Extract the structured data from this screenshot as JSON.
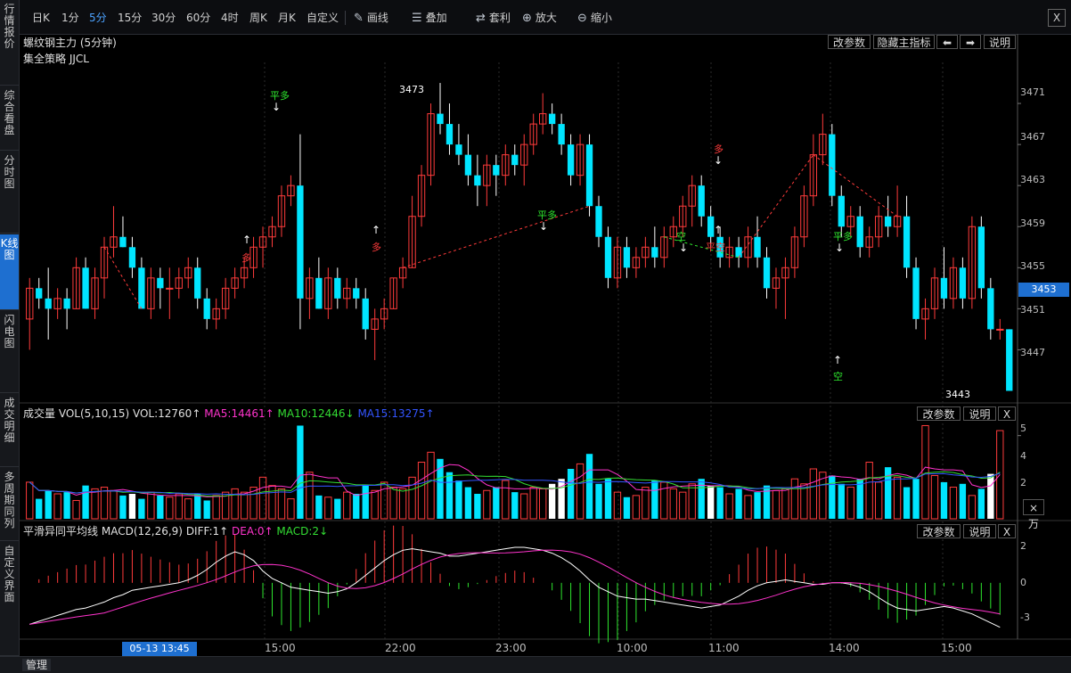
{
  "sidebar": {
    "tabs": [
      {
        "label": "行情报价"
      },
      {
        "label": "综合看盘"
      },
      {
        "label": "分时图"
      },
      {
        "label": "K线图"
      },
      {
        "label": "闪电图"
      },
      {
        "label": "成交明细"
      },
      {
        "label": "多周期同列"
      },
      {
        "label": "自定义界面"
      }
    ]
  },
  "toolbar": {
    "periods": [
      "日K",
      "1分",
      "5分",
      "15分",
      "30分",
      "60分",
      "4时",
      "周K",
      "月K",
      "自定义"
    ],
    "active_period": "5分",
    "tools": [
      "画线",
      "叠加",
      "套利",
      "放大",
      "缩小"
    ],
    "close": "X"
  },
  "main_panel": {
    "title": "螺纹钢主力 (5分钟)",
    "strategy": "集全策略 JJCL",
    "buttons": {
      "params": "改参数",
      "hide_main": "隐藏主指标",
      "left": "⬅",
      "right": "➡",
      "help": "说明"
    },
    "price_axis": [
      "3471",
      "3467",
      "3463",
      "3459",
      "3455",
      "3451",
      "3447"
    ],
    "current_price": "3453",
    "high_label": "3473",
    "low_label": "3443",
    "signals": [
      {
        "text": "平多",
        "color": "green"
      },
      {
        "text": "多",
        "color": "red"
      },
      {
        "text": "多",
        "color": "red"
      },
      {
        "text": "平多",
        "color": "green"
      },
      {
        "text": "空",
        "color": "green"
      },
      {
        "text": "平空",
        "color": "red"
      },
      {
        "text": "多",
        "color": "red"
      },
      {
        "text": "平多",
        "color": "green"
      },
      {
        "text": "空",
        "color": "green"
      }
    ]
  },
  "volume_panel": {
    "label": "成交量",
    "indicator": "VOL(5,10,15)",
    "vol": "VOL:12760↑",
    "ma5": "MA5:14461↑",
    "ma10": "MA10:12446↓",
    "ma15": "MA15:13275↑",
    "buttons": {
      "params": "改参数",
      "help": "说明",
      "close": "X"
    },
    "axis": [
      "5",
      "4",
      "2"
    ],
    "unit": "×万",
    "colors": {
      "ma5": "#ff33cc",
      "ma10": "#33dd33",
      "ma15": "#3355ff"
    }
  },
  "macd_panel": {
    "label": "平滑异同平均线",
    "indicator": "MACD(12,26,9)",
    "diff": "DIFF:1↑",
    "dea": "DEA:0↑",
    "macd": "MACD:2↓",
    "buttons": {
      "params": "改参数",
      "help": "说明",
      "close": "X"
    },
    "axis": [
      "2",
      "0",
      "-3"
    ]
  },
  "time_axis": {
    "cursor": "05-13 13:45",
    "labels": [
      "15:00",
      "22:00",
      "23:00",
      "10:00",
      "11:00",
      "14:00",
      "15:00"
    ]
  },
  "bottom": {
    "manage": "管理"
  },
  "colors": {
    "up": "#ff3b3b",
    "down": "#00e5ff",
    "accent": "#1e6fd0"
  },
  "chart_data": {
    "type": "candlestick",
    "title": "螺纹钢主力 (5分钟)",
    "ylim": [
      3443,
      3473
    ],
    "candles": [
      [
        3450,
        3454,
        3447,
        3453
      ],
      [
        3453,
        3454,
        3451,
        3452
      ],
      [
        3452,
        3455,
        3448,
        3451
      ],
      [
        3451,
        3453,
        3450,
        3452
      ],
      [
        3452,
        3453,
        3449,
        3451
      ],
      [
        3451,
        3456,
        3451,
        3455
      ],
      [
        3455,
        3456,
        3451,
        3451
      ],
      [
        3451,
        3455,
        3450,
        3454
      ],
      [
        3454,
        3458,
        3452,
        3457
      ],
      [
        3457,
        3461,
        3456,
        3458
      ],
      [
        3458,
        3460,
        3457,
        3457
      ],
      [
        3457,
        3458,
        3454,
        3455
      ],
      [
        3455,
        3456,
        3451,
        3451
      ],
      [
        3451,
        3455,
        3450,
        3454
      ],
      [
        3454,
        3455,
        3451,
        3453
      ],
      [
        3453,
        3455,
        3450,
        3453
      ],
      [
        3453,
        3455,
        3452,
        3454
      ],
      [
        3454,
        3456,
        3453,
        3455
      ],
      [
        3455,
        3456,
        3451,
        3452
      ],
      [
        3452,
        3453,
        3449,
        3450
      ],
      [
        3450,
        3452,
        3449,
        3451
      ],
      [
        3451,
        3454,
        3450,
        3453
      ],
      [
        3453,
        3455,
        3452,
        3454
      ],
      [
        3454,
        3456,
        3453,
        3455
      ],
      [
        3455,
        3458,
        3454,
        3457
      ],
      [
        3457,
        3459,
        3455,
        3458
      ],
      [
        3458,
        3460,
        3457,
        3459
      ],
      [
        3459,
        3463,
        3458,
        3462
      ],
      [
        3462,
        3464,
        3461,
        3463
      ],
      [
        3463,
        3468,
        3449,
        3452
      ],
      [
        3452,
        3455,
        3450,
        3454
      ],
      [
        3454,
        3456,
        3451,
        3451
      ],
      [
        3451,
        3455,
        3450,
        3454
      ],
      [
        3454,
        3455,
        3451,
        3452
      ],
      [
        3452,
        3454,
        3451,
        3453
      ],
      [
        3453,
        3454,
        3451,
        3452
      ],
      [
        3452,
        3453,
        3448,
        3449
      ],
      [
        3449,
        3451,
        3446,
        3450
      ],
      [
        3450,
        3452,
        3449,
        3451
      ],
      [
        3451,
        3454,
        3451,
        3454
      ],
      [
        3454,
        3456,
        3453,
        3455
      ],
      [
        3455,
        3462,
        3455,
        3460
      ],
      [
        3460,
        3465,
        3459,
        3464
      ],
      [
        3464,
        3471,
        3463,
        3470
      ],
      [
        3470,
        3473,
        3468,
        3469
      ],
      [
        3469,
        3471,
        3466,
        3467
      ],
      [
        3467,
        3469,
        3465,
        3466
      ],
      [
        3466,
        3468,
        3463,
        3464
      ],
      [
        3464,
        3466,
        3461,
        3463
      ],
      [
        3463,
        3466,
        3461,
        3465
      ],
      [
        3465,
        3466,
        3462,
        3464
      ],
      [
        3464,
        3467,
        3463,
        3466
      ],
      [
        3466,
        3467,
        3464,
        3465
      ],
      [
        3465,
        3468,
        3463,
        3467
      ],
      [
        3467,
        3470,
        3466,
        3469
      ],
      [
        3469,
        3472,
        3468,
        3470
      ],
      [
        3470,
        3471,
        3468,
        3469
      ],
      [
        3469,
        3470,
        3466,
        3467
      ],
      [
        3467,
        3468,
        3463,
        3464
      ],
      [
        3464,
        3468,
        3463,
        3467
      ],
      [
        3467,
        3468,
        3460,
        3461
      ],
      [
        3461,
        3462,
        3457,
        3458
      ],
      [
        3458,
        3459,
        3453,
        3454
      ],
      [
        3454,
        3458,
        3453,
        3457
      ],
      [
        3457,
        3458,
        3454,
        3455
      ],
      [
        3455,
        3457,
        3454,
        3456
      ],
      [
        3456,
        3458,
        3455,
        3457
      ],
      [
        3457,
        3459,
        3455,
        3456
      ],
      [
        3456,
        3459,
        3455,
        3458
      ],
      [
        3458,
        3460,
        3457,
        3459
      ],
      [
        3459,
        3462,
        3458,
        3461
      ],
      [
        3461,
        3464,
        3459,
        3463
      ],
      [
        3463,
        3464,
        3459,
        3460
      ],
      [
        3460,
        3461,
        3457,
        3458
      ],
      [
        3458,
        3459,
        3455,
        3456
      ],
      [
        3456,
        3458,
        3455,
        3457
      ],
      [
        3457,
        3458,
        3455,
        3456
      ],
      [
        3456,
        3459,
        3455,
        3458
      ],
      [
        3458,
        3460,
        3455,
        3456
      ],
      [
        3456,
        3457,
        3452,
        3453
      ],
      [
        3453,
        3455,
        3451,
        3454
      ],
      [
        3454,
        3456,
        3450,
        3455
      ],
      [
        3455,
        3459,
        3454,
        3458
      ],
      [
        3458,
        3463,
        3457,
        3462
      ],
      [
        3462,
        3468,
        3461,
        3466
      ],
      [
        3466,
        3470,
        3465,
        3468
      ],
      [
        3468,
        3469,
        3461,
        3462
      ],
      [
        3462,
        3463,
        3458,
        3459
      ],
      [
        3459,
        3461,
        3458,
        3460
      ],
      [
        3460,
        3461,
        3456,
        3457
      ],
      [
        3457,
        3459,
        3456,
        3458
      ],
      [
        3458,
        3461,
        3457,
        3460
      ],
      [
        3460,
        3462,
        3458,
        3459
      ],
      [
        3459,
        3463,
        3458,
        3460
      ],
      [
        3460,
        3462,
        3454,
        3455
      ],
      [
        3455,
        3456,
        3449,
        3450
      ],
      [
        3450,
        3452,
        3448,
        3451
      ],
      [
        3451,
        3455,
        3450,
        3454
      ],
      [
        3454,
        3457,
        3451,
        3452
      ],
      [
        3452,
        3456,
        3451,
        3455
      ],
      [
        3455,
        3456,
        3451,
        3452
      ],
      [
        3452,
        3460,
        3451,
        3459
      ],
      [
        3459,
        3460,
        3452,
        3453
      ],
      [
        3453,
        3454,
        3448,
        3449
      ],
      [
        3449,
        3450,
        3448,
        3449
      ],
      [
        3449,
        3449,
        3443,
        3443
      ]
    ],
    "volume": [
      2.2,
      1.2,
      1.7,
      1.5,
      1.6,
      1.1,
      2.0,
      1.8,
      1.9,
      1.7,
      1.4,
      1.5,
      1.2,
      1.6,
      1.4,
      1.3,
      1.5,
      1.2,
      1.5,
      1.1,
      1.4,
      1.6,
      1.8,
      1.6,
      1.9,
      2.5,
      2.0,
      1.8,
      1.2,
      5.6,
      2.8,
      1.4,
      1.3,
      1.2,
      1.6,
      1.5,
      2.0,
      1.7,
      2.2,
      1.9,
      1.8,
      2.5,
      3.4,
      4.0,
      3.6,
      2.8,
      2.3,
      1.9,
      1.5,
      1.7,
      1.9,
      2.3,
      1.6,
      1.5,
      1.9,
      1.8,
      2.1,
      2.4,
      3.0,
      3.3,
      3.9,
      2.1,
      2.4,
      1.6,
      1.3,
      1.4,
      1.9,
      2.3,
      2.2,
      1.8,
      1.6,
      2.1,
      2.4,
      2.0,
      1.9,
      1.5,
      1.8,
      1.4,
      1.6,
      2.0,
      1.7,
      1.8,
      2.4,
      2.1,
      3.0,
      2.8,
      2.6,
      2.1,
      1.9,
      2.4,
      3.4,
      2.2,
      3.1,
      2.5,
      1.9,
      2.4,
      5.6,
      2.6,
      2.2,
      1.9,
      2.1,
      1.4,
      1.8,
      2.7,
      5.3
    ],
    "macd_diff": [
      -2.8,
      -2.6,
      -2.4,
      -2.2,
      -2.0,
      -1.8,
      -1.7,
      -1.5,
      -1.3,
      -1.0,
      -0.8,
      -0.5,
      -0.4,
      -0.3,
      -0.2,
      -0.1,
      0.0,
      0.2,
      0.5,
      0.9,
      1.4,
      1.8,
      2.1,
      1.9,
      1.5,
      0.8,
      0.3,
      0.0,
      -0.3,
      -0.4,
      -0.5,
      -0.6,
      -0.7,
      -0.6,
      -0.4,
      0.0,
      0.5,
      1.0,
      1.5,
      1.9,
      2.2,
      2.3,
      2.2,
      2.1,
      2.0,
      1.8,
      1.8,
      1.9,
      2.0,
      2.1,
      2.2,
      2.3,
      2.4,
      2.4,
      2.3,
      2.2,
      2.0,
      1.7,
      1.3,
      0.8,
      0.2,
      -0.3,
      -0.6,
      -0.9,
      -1.0,
      -1.1,
      -1.1,
      -1.2,
      -1.3,
      -1.4,
      -1.5,
      -1.6,
      -1.7,
      -1.6,
      -1.5,
      -1.2,
      -0.9,
      -0.5,
      -0.2,
      0.0,
      0.1,
      0.2,
      0.1,
      0.0,
      -0.1,
      -0.1,
      0.0,
      0.0,
      -0.1,
      -0.3,
      -0.6,
      -1.0,
      -1.4,
      -1.7,
      -1.8,
      -1.9,
      -1.8,
      -1.7,
      -1.6,
      -1.7,
      -1.9,
      -2.1,
      -2.4,
      -2.7,
      -3.0
    ]
  }
}
